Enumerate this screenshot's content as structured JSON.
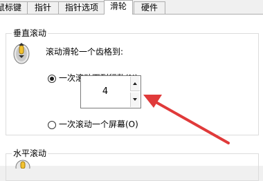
{
  "tabs": [
    {
      "label": "鼠标键",
      "active": false
    },
    {
      "label": "指针",
      "active": false
    },
    {
      "label": "指针选项",
      "active": false
    },
    {
      "label": "滑轮",
      "active": true
    },
    {
      "label": "硬件",
      "active": false
    }
  ],
  "vertical_scroll": {
    "title": "垂直滚动",
    "description": "滚动滑轮一个齿格到:",
    "option_lines_label": "一次滚动下列行数(N):",
    "option_lines_selected": true,
    "lines_value": "4",
    "option_screen_label": "一次滚动一个屏幕(O)",
    "option_screen_selected": false
  },
  "horizontal_scroll": {
    "title": "水平滚动"
  },
  "colors": {
    "annotation_arrow": "#e03a3a"
  },
  "icons": {
    "mouse_wheel": "mouse-wheel-icon",
    "spin_up": "triangle-up",
    "spin_down": "triangle-down"
  }
}
